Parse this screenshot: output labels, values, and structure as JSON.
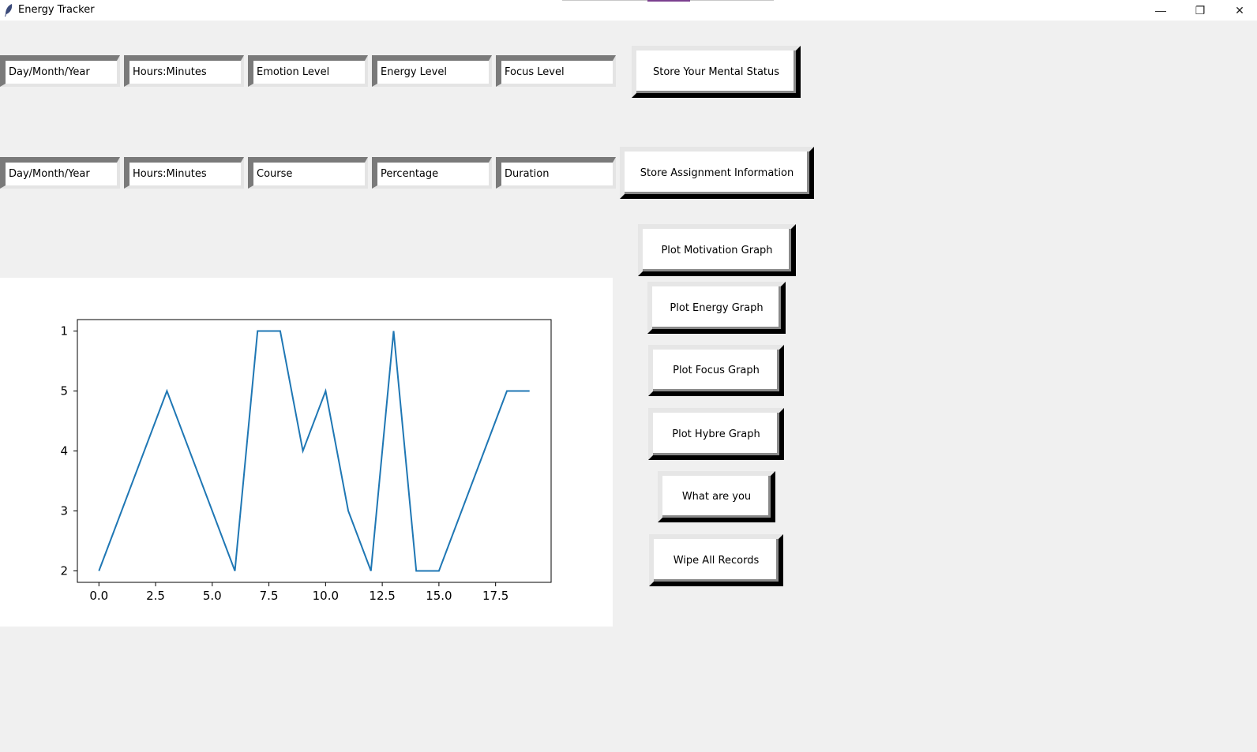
{
  "window": {
    "title": "Energy Tracker",
    "icon": "feather-icon",
    "controls": {
      "minimize": "—",
      "maximize": "❐",
      "close": "✕"
    }
  },
  "mental_status_row": {
    "fields": [
      "Day/Month/Year",
      "Hours:Minutes",
      "Emotion Level",
      "Energy Level",
      "Focus Level"
    ],
    "button": "Store Your Mental Status"
  },
  "assignment_row": {
    "fields": [
      "Day/Month/Year",
      "Hours:Minutes",
      "Course",
      "Percentage",
      "Duration"
    ],
    "button": "Store Assignment Information"
  },
  "graph_buttons": {
    "motivation": "Plot Motivation Graph",
    "energy": "Plot Energy Graph",
    "focus": "Plot Focus Graph",
    "hybrid": "Plot Hybre Graph",
    "what": "What are you",
    "wipe": "Wipe All Records"
  },
  "chart_data": {
    "type": "line",
    "title": "",
    "xlabel": "",
    "ylabel": "",
    "xlim": [
      -0.95,
      19.95
    ],
    "x_ticks": [
      "0.0",
      "2.5",
      "5.0",
      "7.5",
      "10.0",
      "12.5",
      "15.0",
      "17.5"
    ],
    "y_categories": [
      "2",
      "3",
      "4",
      "5",
      "1"
    ],
    "line_color": "#1f77b4",
    "grid": false,
    "series": [
      {
        "x": [
          0,
          3,
          6,
          7,
          8,
          9,
          10,
          11,
          12,
          13,
          14,
          15,
          18,
          19
        ],
        "values": [
          "2",
          "5",
          "2",
          "1",
          "1",
          "4",
          "5",
          "3",
          "2",
          "1",
          "2",
          "2",
          "5",
          "5"
        ]
      }
    ]
  }
}
